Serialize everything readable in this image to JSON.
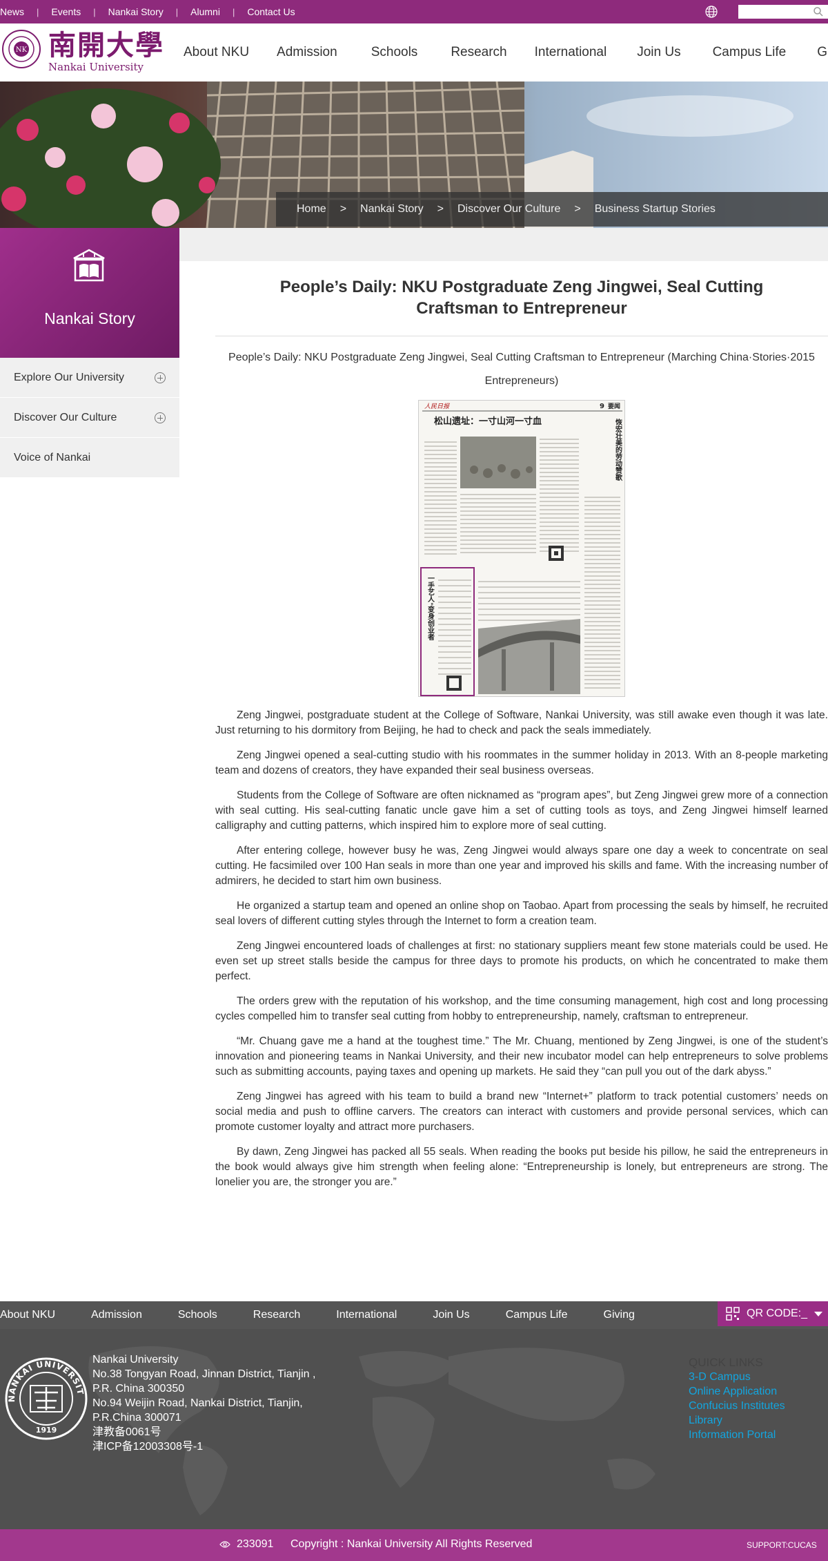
{
  "top": {
    "links": [
      "News",
      "Events",
      "Nankai Story",
      "Alumni",
      "Contact Us"
    ]
  },
  "header": {
    "logo_cn": "南開大學",
    "logo_en": "Nankai University",
    "nav": [
      "About NKU",
      "Admission",
      "Schools",
      "Research",
      "International",
      "Join Us",
      "Campus Life",
      "Giving"
    ]
  },
  "breadcrumb": [
    "Home",
    "Nankai Story",
    "Discover Our Culture",
    "Business Startup Stories"
  ],
  "sidebar": {
    "title": "Nankai Story",
    "items": [
      {
        "label": "Explore Our University",
        "expandable": true
      },
      {
        "label": "Discover Our Culture",
        "expandable": true
      },
      {
        "label": "Voice of Nankai",
        "expandable": false
      }
    ]
  },
  "article": {
    "title": "People’s Daily: NKU Postgraduate Zeng Jingwei, Seal Cutting Craftsman to Entrepreneur",
    "subtitle": "People’s Daily: NKU Postgraduate Zeng Jingwei, Seal Cutting Craftsman to Entrepreneur (Marching China·Stories·2015 Entrepreneurs)",
    "newspaper": {
      "masthead": "人民日报",
      "page": "9",
      "section": "要闻",
      "headline": "松山遗址：一寸山河一寸血",
      "side_headline": "恢宏壮美的劳动赞歌",
      "feature_headline": "一手艺人\"变身创业者"
    },
    "paragraphs": [
      "Zeng Jingwei, postgraduate student at the College of Software, Nankai University, was still awake even though it was late. Just returning to his dormitory from Beijing, he had to check and pack the seals immediately.",
      "Zeng Jingwei opened a seal-cutting studio with his roommates in the summer holiday in 2013. With an 8-people marketing team and dozens of creators, they have expanded their seal business overseas.",
      "Students from the College of Software are often nicknamed as “program apes”, but Zeng Jingwei grew more of a connection with seal cutting. His seal-cutting fanatic uncle gave him a set of cutting tools as toys, and Zeng Jingwei himself learned calligraphy and cutting patterns, which inspired him to explore more of seal cutting.",
      "After entering college, however busy he was, Zeng Jingwei would always spare one day a week to concentrate on seal cutting. He facsimiled over 100 Han seals in more than one year and improved his skills and fame. With the increasing number of admirers, he decided to start him own business.",
      "He organized a startup team and opened an online shop on Taobao. Apart from processing the seals by himself, he recruited seal lovers of different cutting styles through the Internet to form a creation team.",
      "Zeng Jingwei encountered loads of challenges at first: no stationary suppliers meant few stone materials could be used. He even set up street stalls beside the campus for three days to promote his products, on which he concentrated to make them perfect.",
      "The orders grew with the reputation of his workshop, and the time consuming management, high cost and long processing cycles compelled him to transfer seal cutting from hobby to entrepreneurship, namely, craftsman to entrepreneur.",
      "“Mr. Chuang gave me a hand at the toughest time.” The Mr. Chuang, mentioned by Zeng Jingwei, is one of the student’s innovation and pioneering teams in Nankai University, and their new incubator model can help entrepreneurs to solve problems such as submitting accounts, paying taxes and opening up markets. He said they “can pull you out of the dark abyss.”",
      "Zeng Jingwei has agreed with his team to build a brand new “Internet+” platform to track potential customers’ needs on social media and push to offline carvers. The creators can interact with customers and provide personal services, which can promote customer loyalty and attract more purchasers.",
      "By dawn, Zeng Jingwei has packed all 55 seals. When reading the books put beside his pillow, he said the entrepreneurs in the book would always give him strength when feeling alone: “Entrepreneurship is lonely, but entrepreneurs are strong. The lonelier you are, the stronger you are.”"
    ]
  },
  "footer": {
    "nav": [
      "About NKU",
      "Admission",
      "Schools",
      "Research",
      "International",
      "Join Us",
      "Campus Life",
      "Giving"
    ],
    "qr_label": "QR CODE:_",
    "seal_text": "NANKAI UNIVERSITY",
    "seal_year": "1919",
    "address_lines": [
      "Nankai University",
      "No.38 Tongyan Road, Jinnan District, Tianjin , P.R. China 300350",
      "No.94 Weijin Road,  Nankai District, Tianjin, P.R.China  300071",
      "津教备0061号",
      "津ICP备12003308号-1"
    ],
    "quick_links_title": "QUICK LINKS",
    "quick_links": [
      "3-D Campus",
      "Online Application",
      "Confucius Institutes",
      "Library",
      "Information Portal"
    ],
    "visit_count": "233091",
    "copyright": "Copyright : Nankai University All Rights Reserved",
    "support": "SUPPORT:CUCAS"
  },
  "colors": {
    "brand_purple": "#8e2a7c",
    "footer_gray": "#505050",
    "link_blue": "#12a6e0"
  }
}
